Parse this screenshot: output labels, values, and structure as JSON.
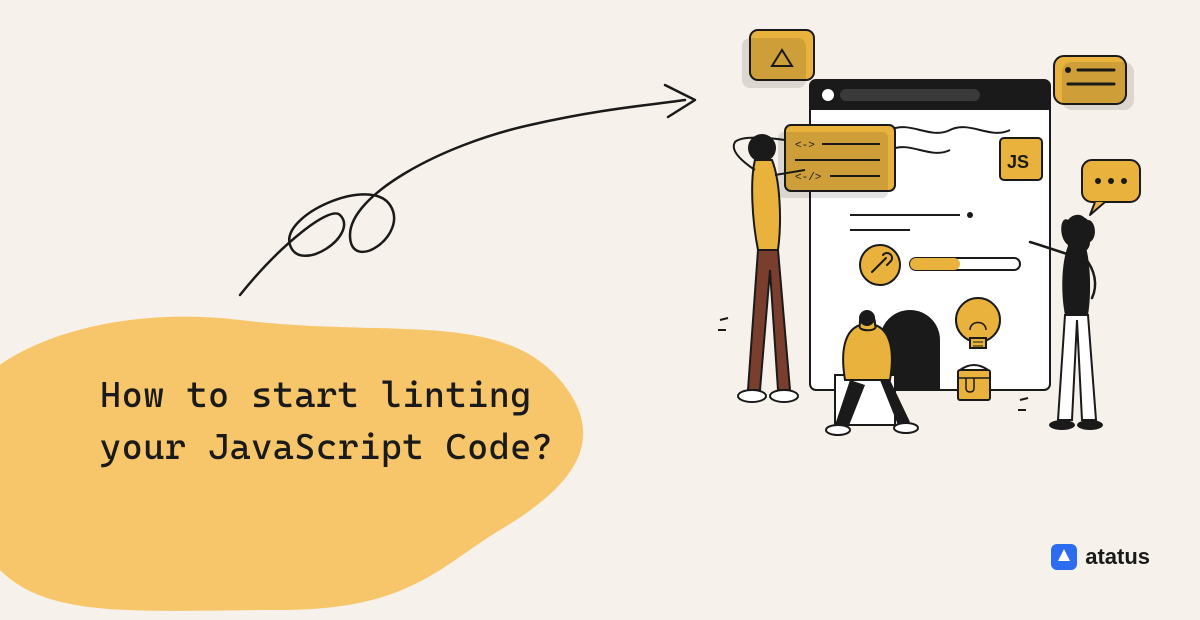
{
  "title_line1": "How to start linting",
  "title_line2": "your JavaScript Code?",
  "brand": "atatus",
  "colors": {
    "background": "#f6f1ea",
    "accent": "#f7c66a",
    "dark": "#1a1a1a",
    "brand_blue": "#2b6cf0",
    "js_yellow": "#e8b23d",
    "brown": "#7a3e2f"
  }
}
